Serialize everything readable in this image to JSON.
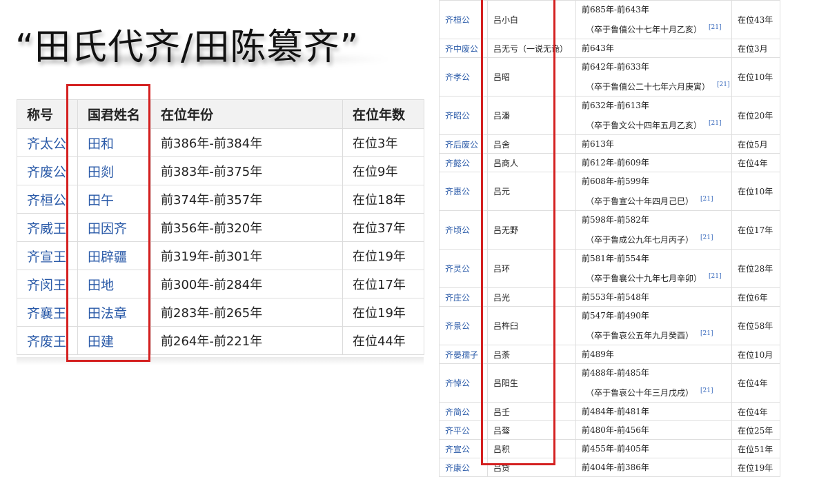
{
  "title": "“田氏代齐/田陈篡齐”",
  "left_table": {
    "headers": [
      "称号",
      "国君姓名",
      "在位年份",
      "在位年数"
    ],
    "rows": [
      [
        "齐太公",
        "田和",
        "前386年-前384年",
        "在位3年"
      ],
      [
        "齐废公",
        "田剡",
        "前383年-前375年",
        "在位9年"
      ],
      [
        "齐桓公",
        "田午",
        "前374年-前357年",
        "在位18年"
      ],
      [
        "齐威王",
        "田因齐",
        "前356年-前320年",
        "在位37年"
      ],
      [
        "齐宣王",
        "田辟疆",
        "前319年-前301年",
        "在位19年"
      ],
      [
        "齐闵王",
        "田地",
        "前300年-前284年",
        "在位17年"
      ],
      [
        "齐襄王",
        "田法章",
        "前283年-前265年",
        "在位19年"
      ],
      [
        "齐废王",
        "田建",
        "前264年-前221年",
        "在位44年"
      ]
    ]
  },
  "right_table": {
    "rows": [
      {
        "title": "齐桓公",
        "name": "吕小白",
        "years": "前685年-前643年",
        "note": "（卒于鲁僖公十七年十月乙亥）",
        "ref": "[21]",
        "reign": "在位43年"
      },
      {
        "title": "齐中废公",
        "name": "吕无亏（一说无诡）",
        "years": "前643年",
        "note": "",
        "ref": "",
        "reign": "在位3月"
      },
      {
        "title": "齐孝公",
        "name": "吕昭",
        "years": "前642年-前633年",
        "note": "（卒于鲁僖公二十七年六月庚寅）",
        "ref": "[21]",
        "reign": "在位10年"
      },
      {
        "title": "齐昭公",
        "name": "吕潘",
        "years": "前632年-前613年",
        "note": "（卒于鲁文公十四年五月乙亥）",
        "ref": "[21]",
        "reign": "在位20年"
      },
      {
        "title": "齐后废公",
        "name": "吕舍",
        "years": "前613年",
        "note": "",
        "ref": "",
        "reign": "在位5月"
      },
      {
        "title": "齐懿公",
        "name": "吕商人",
        "years": "前612年-前609年",
        "note": "",
        "ref": "",
        "reign": "在位4年"
      },
      {
        "title": "齐惠公",
        "name": "吕元",
        "years": "前608年-前599年",
        "note": "（卒于鲁宣公十年四月己巳）",
        "ref": "[21]",
        "reign": "在位10年"
      },
      {
        "title": "齐顷公",
        "name": "吕无野",
        "years": "前598年-前582年",
        "note": "（卒于鲁成公九年七月丙子）",
        "ref": "[21]",
        "reign": "在位17年"
      },
      {
        "title": "齐灵公",
        "name": "吕环",
        "years": "前581年-前554年",
        "note": "（卒于鲁襄公十九年七月辛卯）",
        "ref": "[21]",
        "reign": "在位28年"
      },
      {
        "title": "齐庄公",
        "name": "吕光",
        "years": "前553年-前548年",
        "note": "",
        "ref": "",
        "reign": "在位6年"
      },
      {
        "title": "齐景公",
        "name": "吕杵臼",
        "years": "前547年-前490年",
        "note": "（卒于鲁哀公五年九月癸酉）",
        "ref": "[21]",
        "reign": "在位58年"
      },
      {
        "title": "齐晏孺子",
        "name": "吕荼",
        "years": "前489年",
        "note": "",
        "ref": "",
        "reign": "在位10月"
      },
      {
        "title": "齐悼公",
        "name": "吕阳生",
        "years": "前488年-前485年",
        "note": "（卒于鲁哀公十年三月戊戌）",
        "ref": "[21]",
        "reign": "在位4年"
      },
      {
        "title": "齐简公",
        "name": "吕壬",
        "years": "前484年-前481年",
        "note": "",
        "ref": "",
        "reign": "在位4年"
      },
      {
        "title": "齐平公",
        "name": "吕骜",
        "years": "前480年-前456年",
        "note": "",
        "ref": "",
        "reign": "在位25年"
      },
      {
        "title": "齐宣公",
        "name": "吕积",
        "years": "前455年-前405年",
        "note": "",
        "ref": "",
        "reign": "在位51年"
      },
      {
        "title": "齐康公",
        "name": "吕贷",
        "years": "前404年-前386年",
        "note": "",
        "ref": "",
        "reign": "在位19年"
      }
    ]
  },
  "colors": {
    "highlight": "#d42020",
    "link": "#2a5aa8"
  }
}
